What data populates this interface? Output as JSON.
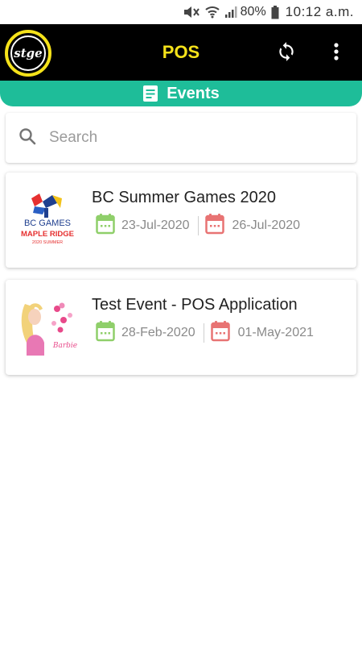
{
  "status_bar": {
    "battery_percent": "80%",
    "time": "10:12 a.m."
  },
  "app_bar": {
    "logo_text": "stge",
    "title": "POS"
  },
  "section": {
    "title": "Events"
  },
  "search": {
    "placeholder": "Search",
    "value": ""
  },
  "events": [
    {
      "title": "BC Summer Games 2020",
      "start_date": "23-Jul-2020",
      "end_date": "26-Jul-2020",
      "logo": {
        "line1": "BC GAMES",
        "line2": "MAPLE RIDGE",
        "line3": "2020 SUMMER"
      }
    },
    {
      "title": "Test Event - POS Application",
      "start_date": "28-Feb-2020",
      "end_date": "01-May-2021",
      "logo": {
        "caption": "Barbie"
      }
    }
  ],
  "colors": {
    "accent_teal": "#1ebd99",
    "brand_yellow": "#f5e21a",
    "start_calendar_green": "#8fcf6a",
    "end_calendar_red": "#e87373"
  }
}
